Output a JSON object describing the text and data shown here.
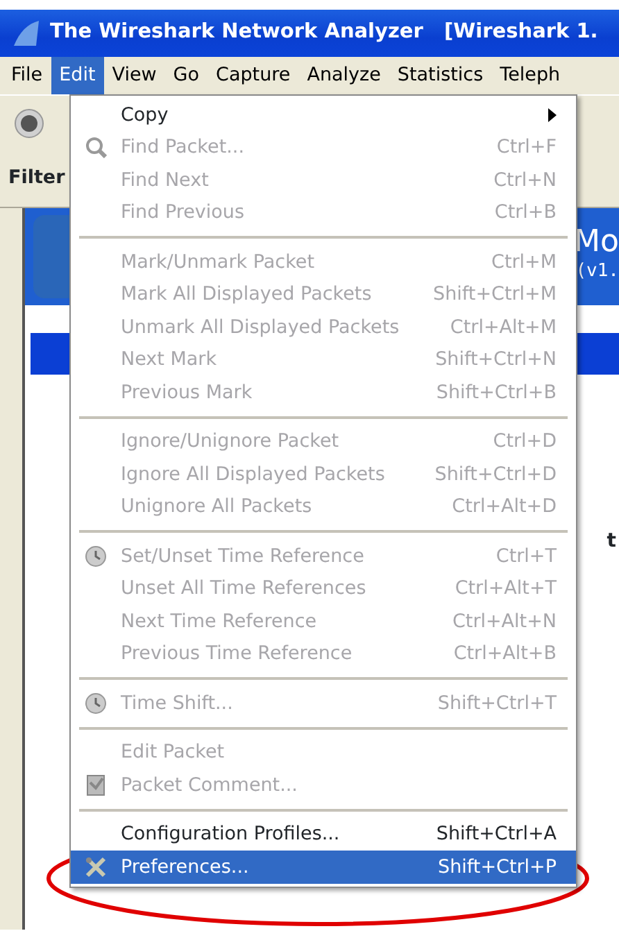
{
  "window": {
    "title": "The Wireshark Network Analyzer   [Wireshark 1."
  },
  "menubar": [
    {
      "label": "File",
      "selected": false
    },
    {
      "label": "Edit",
      "selected": true
    },
    {
      "label": "View",
      "selected": false
    },
    {
      "label": "Go",
      "selected": false
    },
    {
      "label": "Capture",
      "selected": false
    },
    {
      "label": "Analyze",
      "selected": false
    },
    {
      "label": "Statistics",
      "selected": false
    },
    {
      "label": "Teleph",
      "selected": false
    }
  ],
  "filter_label": "Filter",
  "welcome": {
    "heading": "Mo",
    "version": "(v1.",
    "side_text": "t"
  },
  "edit_menu": [
    {
      "kind": "item",
      "label": "Copy",
      "disabled": false,
      "submenu": true
    },
    {
      "kind": "item",
      "label": "Find Packet...",
      "shortcut": "Ctrl+F",
      "disabled": true
    },
    {
      "kind": "item",
      "label": "Find Next",
      "shortcut": "Ctrl+N",
      "disabled": true
    },
    {
      "kind": "item",
      "label": "Find Previous",
      "shortcut": "Ctrl+B",
      "disabled": true
    },
    {
      "kind": "separator"
    },
    {
      "kind": "item",
      "label": "Mark/Unmark Packet",
      "shortcut": "Ctrl+M",
      "disabled": true
    },
    {
      "kind": "item",
      "label": "Mark All Displayed Packets",
      "shortcut": "Shift+Ctrl+M",
      "disabled": true
    },
    {
      "kind": "item",
      "label": "Unmark All Displayed Packets",
      "shortcut": "Ctrl+Alt+M",
      "disabled": true
    },
    {
      "kind": "item",
      "label": "Next Mark",
      "shortcut": "Shift+Ctrl+N",
      "disabled": true
    },
    {
      "kind": "item",
      "label": "Previous Mark",
      "shortcut": "Shift+Ctrl+B",
      "disabled": true
    },
    {
      "kind": "separator"
    },
    {
      "kind": "item",
      "label": "Ignore/Unignore Packet",
      "shortcut": "Ctrl+D",
      "disabled": true
    },
    {
      "kind": "item",
      "label": "Ignore All Displayed Packets",
      "shortcut": "Shift+Ctrl+D",
      "disabled": true
    },
    {
      "kind": "item",
      "label": "Unignore All Packets",
      "shortcut": "Ctrl+Alt+D",
      "disabled": true
    },
    {
      "kind": "separator"
    },
    {
      "kind": "item",
      "label": "Set/Unset Time Reference",
      "shortcut": "Ctrl+T",
      "disabled": true
    },
    {
      "kind": "item",
      "label": "Unset All Time References",
      "shortcut": "Ctrl+Alt+T",
      "disabled": true
    },
    {
      "kind": "item",
      "label": "Next Time Reference",
      "shortcut": "Ctrl+Alt+N",
      "disabled": true
    },
    {
      "kind": "item",
      "label": "Previous Time Reference",
      "shortcut": "Ctrl+Alt+B",
      "disabled": true
    },
    {
      "kind": "separator"
    },
    {
      "kind": "item",
      "label": "Time Shift...",
      "shortcut": "Shift+Ctrl+T",
      "disabled": true
    },
    {
      "kind": "separator"
    },
    {
      "kind": "item",
      "label": "Edit Packet",
      "disabled": true
    },
    {
      "kind": "item",
      "label": "Packet Comment...",
      "disabled": true
    },
    {
      "kind": "separator"
    },
    {
      "kind": "item",
      "label": "Configuration Profiles...",
      "shortcut": "Shift+Ctrl+A",
      "disabled": false
    },
    {
      "kind": "item",
      "label": "Preferences...",
      "shortcut": "Shift+Ctrl+P",
      "disabled": false,
      "selected": true
    }
  ]
}
